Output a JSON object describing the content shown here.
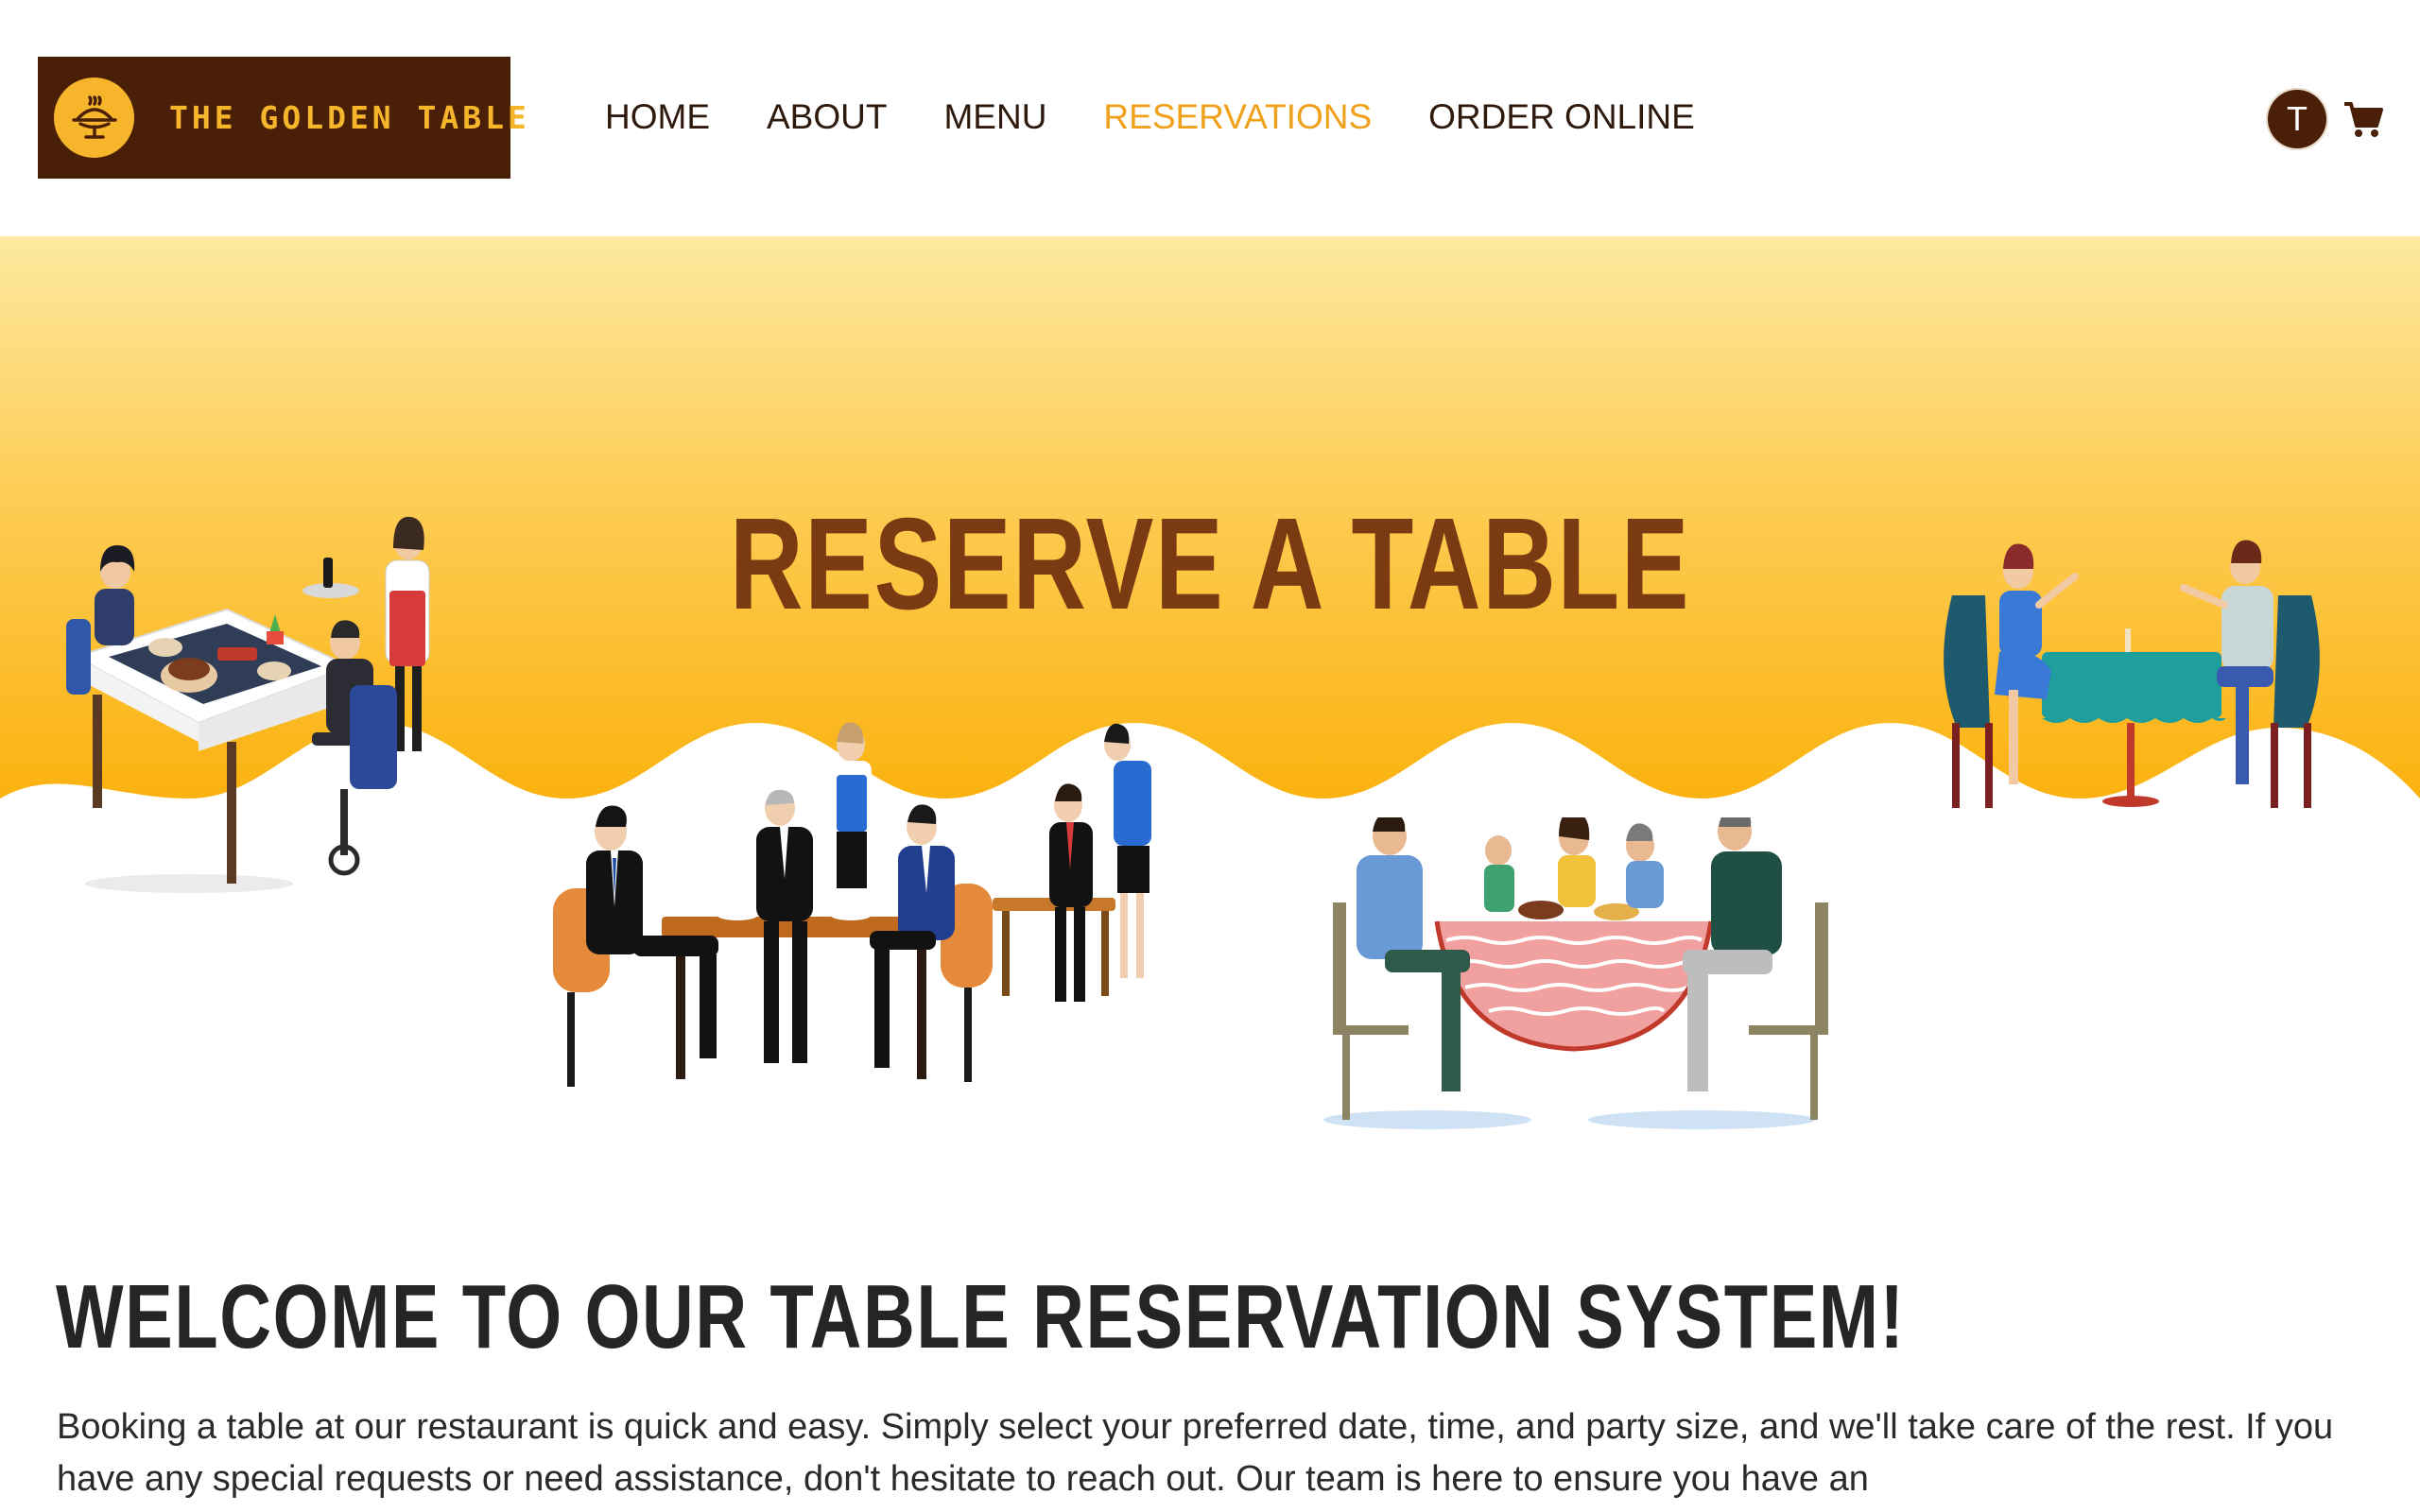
{
  "brand": {
    "name": "THE GOLDEN TABLE",
    "logo_icon": "serving-dish-icon"
  },
  "nav": {
    "items": [
      {
        "label": "HOME",
        "active": false
      },
      {
        "label": "ABOUT",
        "active": false
      },
      {
        "label": "MENU",
        "active": false
      },
      {
        "label": "RESERVATIONS",
        "active": true
      },
      {
        "label": "ORDER ONLINE",
        "active": false
      }
    ]
  },
  "user": {
    "avatar_initial": "T"
  },
  "cart": {
    "icon": "shopping-cart-icon"
  },
  "hero": {
    "title": "RESERVE A TABLE"
  },
  "content": {
    "heading": "WELCOME TO OUR TABLE RESERVATION SYSTEM!",
    "paragraph": "Booking a table at our restaurant is quick and easy. Simply select your preferred date, time, and party size, and we'll take care of the rest. If you have any special requests or need assistance, don't hesitate to reach out. Our team is here to ensure you have an"
  },
  "colors": {
    "brand_dark": "#4a1f07",
    "brand_gold": "#f7b52c",
    "nav_active": "#f0a11b",
    "hero_title": "#7a3a12",
    "hero_gradient_top": "#fde9a0",
    "hero_gradient_bottom": "#fbb20f"
  }
}
